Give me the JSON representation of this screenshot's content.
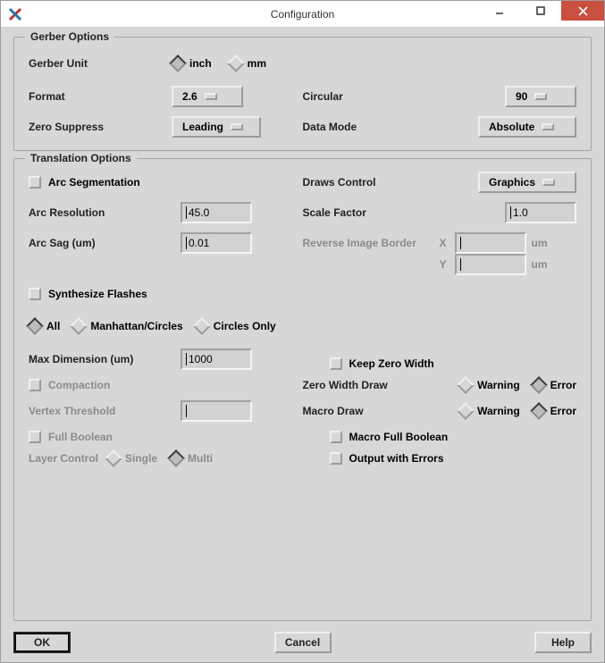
{
  "window": {
    "title": "Configuration"
  },
  "gerber": {
    "legend": "Gerber Options",
    "unit_label": "Gerber Unit",
    "unit_inch": "inch",
    "unit_mm": "mm",
    "format_label": "Format",
    "format_value": "2.6",
    "circular_label": "Circular",
    "circular_value": "90",
    "zero_label": "Zero Suppress",
    "zero_value": "Leading",
    "datamode_label": "Data Mode",
    "datamode_value": "Absolute"
  },
  "trans": {
    "legend": "Translation Options",
    "arc_seg_label": "Arc Segmentation",
    "draws_control_label": "Draws Control",
    "draws_control_value": "Graphics",
    "arc_res_label": "Arc Resolution",
    "arc_res_value": "45.0",
    "scale_label": "Scale Factor",
    "scale_value": "1.0",
    "arc_sag_label": "Arc Sag (um)",
    "arc_sag_value": "0.01",
    "rev_border_label": "Reverse Image Border",
    "rev_x_label": "X",
    "rev_x_value": "",
    "rev_y_label": "Y",
    "rev_y_value": "",
    "rev_unit": "um",
    "synth_label": "Synthesize Flashes",
    "rad_all": "All",
    "rad_mc": "Manhattan/Circles",
    "rad_co": "Circles Only",
    "maxdim_label": "Max Dimension (um)",
    "maxdim_value": "1000",
    "keepzero_label": "Keep Zero Width",
    "compaction_label": "Compaction",
    "zerodraw_label": "Zero Width Draw",
    "warning": "Warning",
    "error": "Error",
    "vertex_label": "Vertex Threshold",
    "vertex_value": "",
    "macrodraw_label": "Macro Draw",
    "fullbool_label": "Full Boolean",
    "macrofull_label": "Macro Full Boolean",
    "layercontrol_label": "Layer Control",
    "lc_single": "Single",
    "lc_multi": "Multi",
    "outerr_label": "Output with Errors"
  },
  "buttons": {
    "ok": "OK",
    "cancel": "Cancel",
    "help": "Help"
  }
}
